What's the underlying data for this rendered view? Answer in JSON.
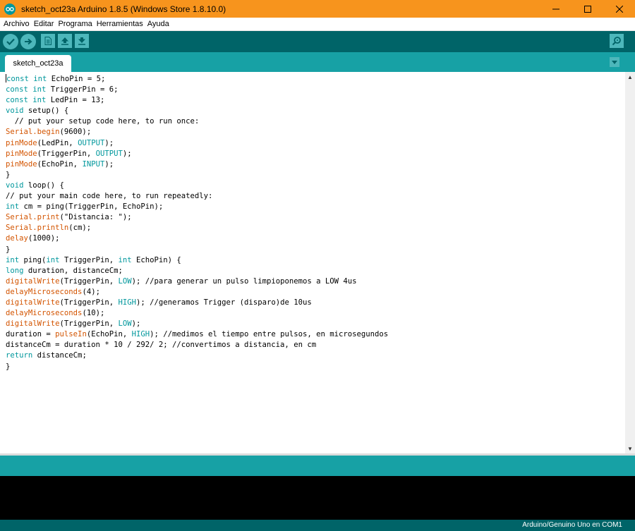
{
  "window": {
    "title": "sketch_oct23a Arduino 1.8.5 (Windows Store 1.8.10.0)",
    "controls": [
      "minimize",
      "maximize",
      "close"
    ]
  },
  "menu": [
    "Archivo",
    "Editar",
    "Programa",
    "Herramientas",
    "Ayuda"
  ],
  "toolbar": {
    "buttons": [
      "verify",
      "upload",
      "new",
      "open",
      "save"
    ],
    "serial_monitor": "serial-monitor"
  },
  "tabs": [
    {
      "label": "sketch_oct23a"
    }
  ],
  "code_lines": [
    "const int EchoPin = 5;",
    "const int TriggerPin = 6;",
    "const int LedPin = 13;",
    "void setup() {",
    "  // put your setup code here, to run once:",
    "Serial.begin(9600);",
    "pinMode(LedPin, OUTPUT);",
    "pinMode(TriggerPin, OUTPUT);",
    "pinMode(EchoPin, INPUT);",
    "}",
    "void loop() {",
    "// put your main code here, to run repeatedly:",
    "int cm = ping(TriggerPin, EchoPin);",
    "Serial.print(\"Distancia: \");",
    "Serial.println(cm);",
    "delay(1000);",
    "}",
    "int ping(int TriggerPin, int EchoPin) {",
    "long duration, distanceCm;",
    "digitalWrite(TriggerPin, LOW); //para generar un pulso limpioponemos a LOW 4us",
    "delayMicroseconds(4);",
    "digitalWrite(TriggerPin, HIGH); //generamos Trigger (disparo)de 10us",
    "delayMicroseconds(10);",
    "digitalWrite(TriggerPin, LOW);",
    "duration = pulseIn(EchoPin, HIGH); //medimos el tiempo entre pulsos, en microsegundos",
    "distanceCm = duration * 10 / 292/ 2; //convertimos a distancia, en cm",
    "return distanceCm;",
    "}"
  ],
  "status": {
    "board": "Arduino/Genuino Uno en COM1"
  },
  "colors": {
    "titlebar": "#f7941d",
    "toolbar": "#006468",
    "tabbar": "#17a1a5",
    "keyword": "#00979c",
    "function": "#d35400"
  }
}
